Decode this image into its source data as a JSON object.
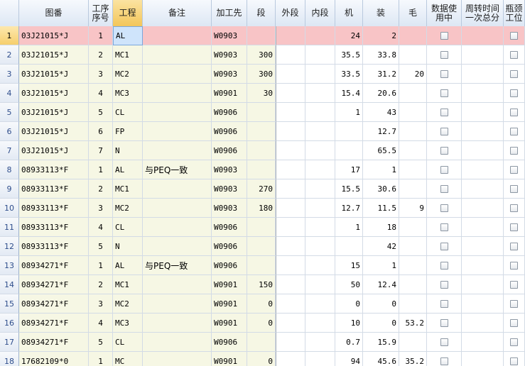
{
  "columns": [
    {
      "key": "rownum",
      "label": "",
      "w": 27
    },
    {
      "key": "part",
      "label": "图番",
      "w": 98
    },
    {
      "key": "seq",
      "label": "工序\n序号",
      "w": 34
    },
    {
      "key": "proc",
      "label": "工程",
      "w": 42
    },
    {
      "key": "note",
      "label": "备注",
      "w": 97
    },
    {
      "key": "vendor",
      "label": "加工先",
      "w": 50
    },
    {
      "key": "dan",
      "label": "段",
      "w": 40
    },
    {
      "key": "outer",
      "label": "外段",
      "w": 42
    },
    {
      "key": "inner",
      "label": "内段",
      "w": 42
    },
    {
      "key": "machine",
      "label": "机",
      "w": 39
    },
    {
      "key": "assy",
      "label": "装",
      "w": 51
    },
    {
      "key": "mao",
      "label": "毛",
      "w": 39
    },
    {
      "key": "inuse",
      "label": "数据使\n用中",
      "w": 49
    },
    {
      "key": "turnover",
      "label": "周转时间\n一次总分",
      "w": 59
    },
    {
      "key": "quota",
      "label": "瓶颈\n工位",
      "w": 30
    }
  ],
  "rows": [
    {
      "n": "1",
      "part": "03J21015*J",
      "seq": "1",
      "proc": "AL",
      "note": "",
      "vendor": "W0903",
      "dan": "",
      "outer": "",
      "inner": "",
      "machine": "24",
      "assy": "2",
      "mao": ""
    },
    {
      "n": "2",
      "part": "03J21015*J",
      "seq": "2",
      "proc": "MC1",
      "note": "",
      "vendor": "W0903",
      "dan": "300",
      "outer": "",
      "inner": "",
      "machine": "35.5",
      "assy": "33.8",
      "mao": ""
    },
    {
      "n": "3",
      "part": "03J21015*J",
      "seq": "3",
      "proc": "MC2",
      "note": "",
      "vendor": "W0903",
      "dan": "300",
      "outer": "",
      "inner": "",
      "machine": "33.5",
      "assy": "31.2",
      "mao": "20"
    },
    {
      "n": "4",
      "part": "03J21015*J",
      "seq": "4",
      "proc": "MC3",
      "note": "",
      "vendor": "W0901",
      "dan": "30",
      "outer": "",
      "inner": "",
      "machine": "15.4",
      "assy": "20.6",
      "mao": ""
    },
    {
      "n": "5",
      "part": "03J21015*J",
      "seq": "5",
      "proc": "CL",
      "note": "",
      "vendor": "W0906",
      "dan": "",
      "outer": "",
      "inner": "",
      "machine": "1",
      "assy": "43",
      "mao": ""
    },
    {
      "n": "6",
      "part": "03J21015*J",
      "seq": "6",
      "proc": "FP",
      "note": "",
      "vendor": "W0906",
      "dan": "",
      "outer": "",
      "inner": "",
      "machine": "",
      "assy": "12.7",
      "mao": ""
    },
    {
      "n": "7",
      "part": "03J21015*J",
      "seq": "7",
      "proc": "N",
      "note": "",
      "vendor": "W0906",
      "dan": "",
      "outer": "",
      "inner": "",
      "machine": "",
      "assy": "65.5",
      "mao": ""
    },
    {
      "n": "8",
      "part": "08933113*F",
      "seq": "1",
      "proc": "AL",
      "note": "与PEQ一致",
      "vendor": "W0903",
      "dan": "",
      "outer": "",
      "inner": "",
      "machine": "17",
      "assy": "1",
      "mao": ""
    },
    {
      "n": "9",
      "part": "08933113*F",
      "seq": "2",
      "proc": "MC1",
      "note": "",
      "vendor": "W0903",
      "dan": "270",
      "outer": "",
      "inner": "",
      "machine": "15.5",
      "assy": "30.6",
      "mao": ""
    },
    {
      "n": "10",
      "part": "08933113*F",
      "seq": "3",
      "proc": "MC2",
      "note": "",
      "vendor": "W0903",
      "dan": "180",
      "outer": "",
      "inner": "",
      "machine": "12.7",
      "assy": "11.5",
      "mao": "9"
    },
    {
      "n": "11",
      "part": "08933113*F",
      "seq": "4",
      "proc": "CL",
      "note": "",
      "vendor": "W0906",
      "dan": "",
      "outer": "",
      "inner": "",
      "machine": "1",
      "assy": "18",
      "mao": ""
    },
    {
      "n": "12",
      "part": "08933113*F",
      "seq": "5",
      "proc": "N",
      "note": "",
      "vendor": "W0906",
      "dan": "",
      "outer": "",
      "inner": "",
      "machine": "",
      "assy": "42",
      "mao": ""
    },
    {
      "n": "13",
      "part": "08934271*F",
      "seq": "1",
      "proc": "AL",
      "note": "与PEQ一致",
      "vendor": "W0906",
      "dan": "",
      "outer": "",
      "inner": "",
      "machine": "15",
      "assy": "1",
      "mao": ""
    },
    {
      "n": "14",
      "part": "08934271*F",
      "seq": "2",
      "proc": "MC1",
      "note": "",
      "vendor": "W0901",
      "dan": "150",
      "outer": "",
      "inner": "",
      "machine": "50",
      "assy": "12.4",
      "mao": ""
    },
    {
      "n": "15",
      "part": "08934271*F",
      "seq": "3",
      "proc": "MC2",
      "note": "",
      "vendor": "W0901",
      "dan": "0",
      "outer": "",
      "inner": "",
      "machine": "0",
      "assy": "0",
      "mao": ""
    },
    {
      "n": "16",
      "part": "08934271*F",
      "seq": "4",
      "proc": "MC3",
      "note": "",
      "vendor": "W0901",
      "dan": "0",
      "outer": "",
      "inner": "",
      "machine": "10",
      "assy": "0",
      "mao": "53.2"
    },
    {
      "n": "17",
      "part": "08934271*F",
      "seq": "5",
      "proc": "CL",
      "note": "",
      "vendor": "W0906",
      "dan": "",
      "outer": "",
      "inner": "",
      "machine": "0.7",
      "assy": "15.9",
      "mao": ""
    },
    {
      "n": "18",
      "part": "17682109*0",
      "seq": "1",
      "proc": "MC",
      "note": "",
      "vendor": "W0901",
      "dan": "0",
      "outer": "",
      "inner": "",
      "machine": "94",
      "assy": "45.6",
      "mao": "35.2"
    }
  ],
  "selected_row": "1",
  "current_column": "proc",
  "colors": {
    "selected_row": "#f8c4c6",
    "current_cell": "#cfe4fb",
    "left_pane": "#f6f7e4",
    "header_selected": "#f3c65a"
  }
}
